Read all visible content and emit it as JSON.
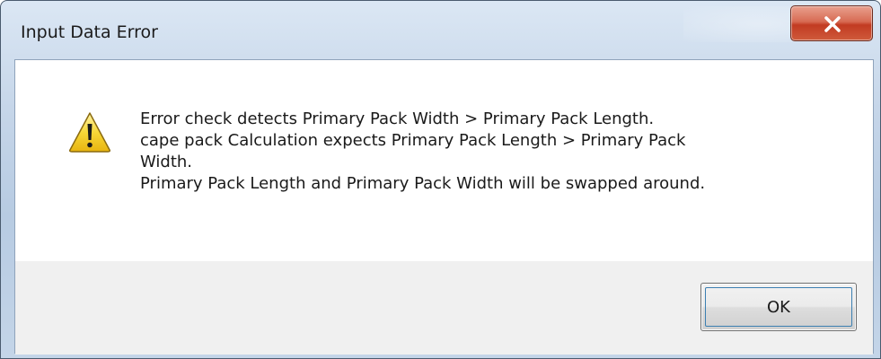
{
  "window": {
    "title": "Input Data Error",
    "close_icon": "close-icon"
  },
  "dialog": {
    "icon": "warning-icon",
    "message_lines": [
      "Error check detects Primary Pack Width > Primary Pack Length.",
      "cape pack Calculation expects Primary Pack Length > Primary Pack",
      "Width.",
      "Primary Pack Length and Primary Pack Width will be swapped around."
    ]
  },
  "buttons": {
    "ok_label": "OK"
  },
  "colors": {
    "close_button": "#c23b22",
    "warning_fill": "#f5d020",
    "focus_ring": "#3c7fb1"
  }
}
